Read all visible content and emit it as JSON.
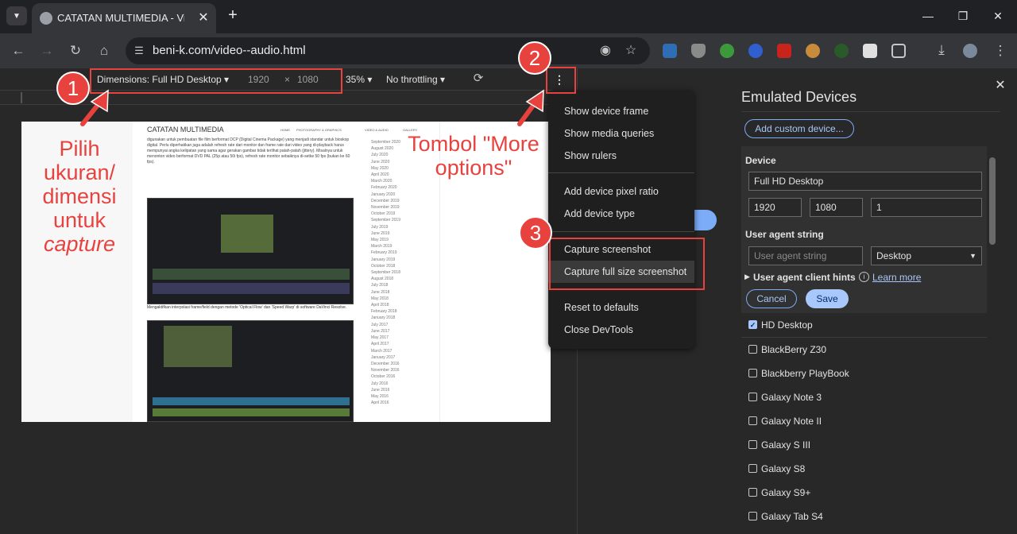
{
  "browser": {
    "tab_title": "CATATAN MULTIMEDIA - Video",
    "tab_close": "✕",
    "new_tab": "+",
    "url": "beni-k.com/video--audio.html",
    "window_controls": [
      "—",
      "❐",
      "✕"
    ],
    "nav": {
      "back": "←",
      "forward": "→",
      "reload": "↻",
      "home": "⌂"
    }
  },
  "device_toolbar": {
    "dimensions_label": "Dimensions: Full HD Desktop ▾",
    "width": "1920",
    "times": "×",
    "height": "1080",
    "zoom": "35% ▾",
    "throttling": "No throttling ▾",
    "more_icon": "⋮"
  },
  "page": {
    "site_title": "CATATAN MULTIMEDIA",
    "nav": [
      "HOME",
      "PHOTOGRAPHY & GRAPHICS",
      "VIDEO & AUDIO",
      "GALLERY"
    ],
    "article": "digunakan untuk pembuatan file film berformat DCP (Digital Cinema Package) yang menjadi standar untuk bioskop digital. Perlu diperhatikan juga adalah refresh rate dari monitor dan frame rate dari video yang di-playback harus mempunyai angka kelipatan yang sama agar gerakan gambar tidak terlihat patah-patah (jittery). Misalnya untuk menonton video berformat DVD PAL (25p atau 50i fps), refresh rate monitor sebaiknya di-setke 50 fps (bukan ke 60 fps).",
    "caption": "Mengaktifkan interpolasi frame/field dengan metode 'Optical Flow' dan 'Speed Warp' di software DaVinci Resolve.",
    "archive": [
      "September 2020",
      "August 2020",
      "July 2020",
      "June 2020",
      "May 2020",
      "April 2020",
      "March 2020",
      "February 2020",
      "January 2020",
      "December 2019",
      "November 2019",
      "October 2019",
      "September 2019",
      "July 2019",
      "June 2019",
      "May 2019",
      "March 2019",
      "February 2019",
      "January 2019",
      "October 2018",
      "September 2018",
      "August 2018",
      "July 2018",
      "June 2018",
      "May 2018",
      "April 2018",
      "February 2018",
      "January 2018",
      "July 2017",
      "June 2017",
      "May 2017",
      "April 2017",
      "March 2017",
      "January 2017",
      "December 2016",
      "November 2016",
      "October 2016",
      "July 2016",
      "June 2016",
      "May 2016",
      "April 2016"
    ]
  },
  "menu": {
    "items": [
      "Show device frame",
      "Show media queries",
      "Show rulers",
      "Add device pixel ratio",
      "Add device type",
      "Capture screenshot",
      "Capture full size screenshot",
      "Reset to defaults",
      "Close DevTools"
    ]
  },
  "panel": {
    "title": "Emulated Devices",
    "close": "✕",
    "add_custom": "Add custom device...",
    "device_label": "Device",
    "device_name": "Full HD Desktop",
    "width": "1920",
    "height": "1080",
    "dpr": "1",
    "ua_label": "User agent string",
    "ua_placeholder": "User agent string",
    "ua_type": "Desktop",
    "ua_hints": "User agent client hints",
    "learn_more": "Learn more",
    "cancel": "Cancel",
    "save": "Save",
    "devices": [
      {
        "name": "HD Desktop",
        "checked": true
      },
      {
        "name": "BlackBerry Z30",
        "checked": false
      },
      {
        "name": "Blackberry PlayBook",
        "checked": false
      },
      {
        "name": "Galaxy Note 3",
        "checked": false
      },
      {
        "name": "Galaxy Note II",
        "checked": false
      },
      {
        "name": "Galaxy S III",
        "checked": false
      },
      {
        "name": "Galaxy S8",
        "checked": false
      },
      {
        "name": "Galaxy S9+",
        "checked": false
      },
      {
        "name": "Galaxy Tab S4",
        "checked": false
      }
    ]
  },
  "annotations": {
    "badge1": "1",
    "badge2": "2",
    "badge3": "3",
    "text1_lines": [
      "Pilih",
      "ukuran/",
      "dimensi",
      "untuk"
    ],
    "text1_italic": "capture",
    "text2_lines": [
      "Tombol \"More",
      "options\""
    ],
    "color": "#e8423f"
  }
}
